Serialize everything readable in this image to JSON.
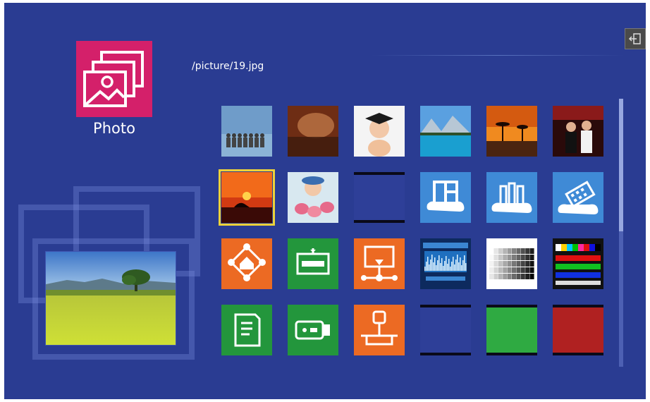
{
  "app": {
    "title": "Photo",
    "icon": "photo-gallery-icon",
    "accent": "#d4206a"
  },
  "current_path": "/picture/19.jpg",
  "exit": {
    "icon": "exit-icon"
  },
  "preview": {
    "name": "field-with-tree"
  },
  "tiles": [
    {
      "name": "thumb-group-photo",
      "kind": "photo"
    },
    {
      "name": "thumb-warm-blur",
      "kind": "photo"
    },
    {
      "name": "thumb-graduate-baby",
      "kind": "photo"
    },
    {
      "name": "thumb-mountain-lake",
      "kind": "photo"
    },
    {
      "name": "thumb-savanna-sunset",
      "kind": "photo"
    },
    {
      "name": "thumb-party-people",
      "kind": "photo"
    },
    {
      "name": "thumb-beach-sunset",
      "kind": "photo",
      "selected": true
    },
    {
      "name": "thumb-child-cupcakes",
      "kind": "photo"
    },
    {
      "name": "thumb-blank",
      "kind": "blank"
    },
    {
      "name": "thumb-layout-cloud",
      "kind": "icon",
      "icon": "layout-cloud-icon",
      "color": "#3f8ad6"
    },
    {
      "name": "thumb-chart-cloud",
      "kind": "icon",
      "icon": "bar-chart-cloud-icon",
      "color": "#3f8ad6"
    },
    {
      "name": "thumb-film-cloud",
      "kind": "icon",
      "icon": "film-cloud-icon",
      "color": "#3f8ad6"
    },
    {
      "name": "thumb-home-network",
      "kind": "icon",
      "icon": "home-network-icon",
      "color": "#ec6a23"
    },
    {
      "name": "thumb-memory-card",
      "kind": "icon",
      "icon": "memory-module-icon",
      "color": "#23963c"
    },
    {
      "name": "thumb-network-display",
      "kind": "icon",
      "icon": "network-display-icon",
      "color": "#ec6a23"
    },
    {
      "name": "thumb-audio-screen",
      "kind": "screen"
    },
    {
      "name": "thumb-grayscale-chart",
      "kind": "pattern-gray"
    },
    {
      "name": "thumb-color-bars",
      "kind": "pattern-color"
    },
    {
      "name": "thumb-sd-card",
      "kind": "icon",
      "icon": "sd-card-icon",
      "color": "#23963c"
    },
    {
      "name": "thumb-usb-drive",
      "kind": "icon",
      "icon": "usb-drive-icon",
      "color": "#23963c"
    },
    {
      "name": "thumb-usb-storage",
      "kind": "icon",
      "icon": "usb-storage-icon",
      "color": "#ec6a23"
    },
    {
      "name": "thumb-solid-blue",
      "kind": "solid",
      "color": "#2e3f98"
    },
    {
      "name": "thumb-solid-green",
      "kind": "solid",
      "color": "#2faa42"
    },
    {
      "name": "thumb-solid-red",
      "kind": "solid",
      "color": "#b02121"
    }
  ]
}
